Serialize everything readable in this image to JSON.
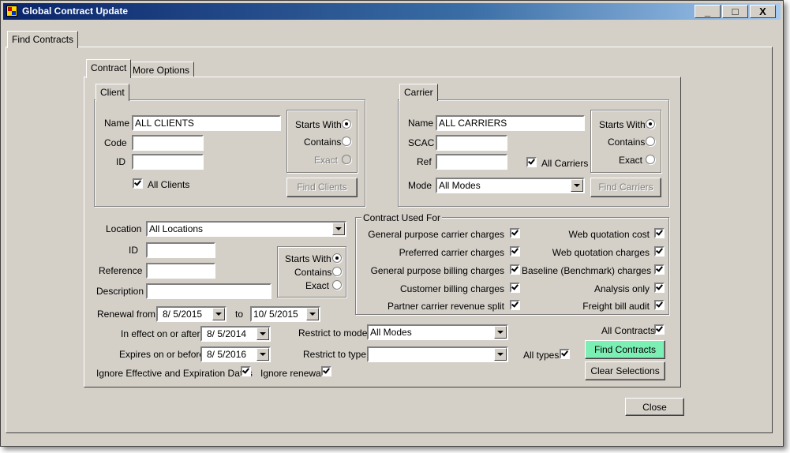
{
  "window": {
    "title": "Global Contract Update",
    "minimize": "_",
    "maximize": "□",
    "close": "X"
  },
  "outer_tab": "Find Contracts",
  "inner_tabs": [
    "Contract",
    "More Options"
  ],
  "client": {
    "tab": "Client",
    "name_label": "Name",
    "name_value": "ALL CLIENTS",
    "code_label": "Code",
    "code_value": "",
    "id_label": "ID",
    "id_value": "",
    "all_label": "All Clients",
    "match": {
      "starts_with": "Starts With",
      "contains": "Contains",
      "exact": "Exact"
    },
    "find_button": "Find Clients"
  },
  "carrier": {
    "tab": "Carrier",
    "name_label": "Name",
    "name_value": "ALL CARRIERS",
    "scac_label": "SCAC",
    "scac_value": "",
    "ref_label": "Ref",
    "ref_value": "",
    "all_label": "All Carriers",
    "mode_label": "Mode",
    "mode_value": "All Modes",
    "match": {
      "starts_with": "Starts With",
      "contains": "Contains",
      "exact": "Exact"
    },
    "find_button": "Find Carriers"
  },
  "location": {
    "location_label": "Location",
    "location_value": "All Locations",
    "id_label": "ID",
    "id_value": "",
    "reference_label": "Reference",
    "reference_value": "",
    "description_label": "Description",
    "description_value": "",
    "match": {
      "starts_with": "Starts With",
      "contains": "Contains",
      "exact": "Exact"
    }
  },
  "contract_used_for": {
    "title": "Contract Used For",
    "left": [
      "General purpose carrier charges",
      "Preferred carrier charges",
      "General purpose billing charges",
      "Customer billing charges",
      "Partner carrier revenue split"
    ],
    "right": [
      "Web quotation cost",
      "Web quotation charges",
      "Baseline (Benchmark) charges",
      "Analysis only",
      "Freight bill audit"
    ]
  },
  "dates": {
    "renewal_from_label": "Renewal from",
    "renewal_from": "8/ 5/2015",
    "to_label": "to",
    "renewal_to": "10/ 5/2015",
    "effective_label": "In effect on or after",
    "effective": "8/ 5/2014",
    "expires_label": "Expires on or before",
    "expires": "8/ 5/2016",
    "ignore_dates_label": "Ignore Effective and Expiration Dates",
    "ignore_renewal_label": "Ignore renewal"
  },
  "restrict": {
    "mode_label": "Restrict to mode",
    "mode_value": "All Modes",
    "type_label": "Restrict to type",
    "type_value": "",
    "all_types_label": "All types"
  },
  "actions": {
    "all_contracts_label": "All Contracts",
    "find_contracts": "Find Contracts",
    "clear_selections": "Clear Selections",
    "close": "Close"
  },
  "colors": {
    "face": "#d4d0c8",
    "title_start": "#0a246a",
    "title_end": "#a6caf0",
    "find_button": "#7cf0b4"
  }
}
